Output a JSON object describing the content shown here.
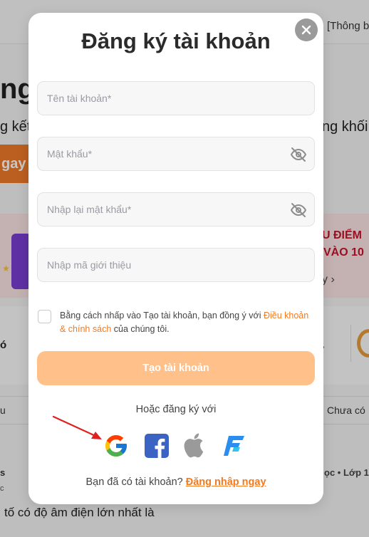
{
  "background": {
    "top_note": "[Thông b",
    "headline": "ng",
    "line_left": "g kết",
    "line_right": "ng khối",
    "cta_label": "gay",
    "banner_line1": "U ĐIỂM",
    "banner_line2": "VÀO 10",
    "banner_arrow": "y ›",
    "card_fragment": "ó",
    "tab_left": "u",
    "tab_right": "Chưa có",
    "small_s": "s",
    "small_c": "c",
    "right_meta": "ọc • Lớp 1",
    "question_text": "tố có độ âm điện lớn nhất là"
  },
  "modal": {
    "title": "Đăng ký tài khoản",
    "close_icon": "close-icon",
    "fields": {
      "username_placeholder": "Tên tài khoản*",
      "password_placeholder": "Mật khẩu*",
      "confirm_password_placeholder": "Nhập lại mật khẩu*",
      "referral_placeholder": "Nhập mã giới thiệu"
    },
    "terms": {
      "prefix": "Bằng cách nhấp vào Tạo tài khoản, bạn đồng ý với ",
      "link": "Điều khoản & chính sách",
      "suffix": " của chúng tôi."
    },
    "submit_label": "Tạo tài khoản",
    "or_label": "Hoặc đăng ký với",
    "social_icons": [
      "google-icon",
      "facebook-icon",
      "apple-icon",
      "f-brand-icon"
    ],
    "login_prompt": "Bạn đã có tài khoản? ",
    "login_link": "Đăng nhập ngay"
  },
  "colors": {
    "accent": "#f47a20",
    "submit_bg": "#ffc08a",
    "annotation": "#e02020"
  }
}
